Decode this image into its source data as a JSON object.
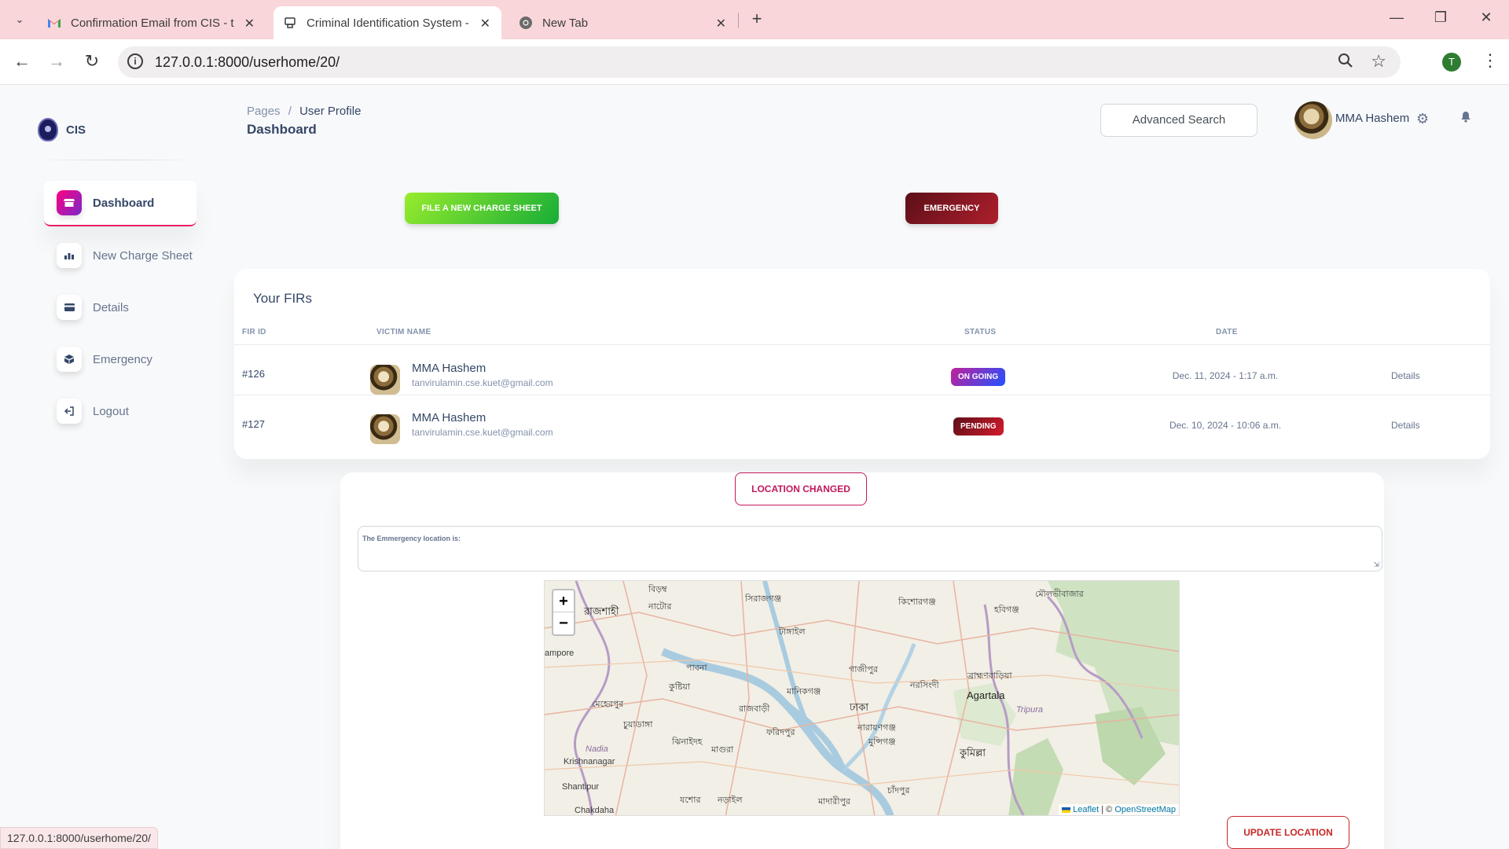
{
  "browser": {
    "tabs": [
      {
        "title": "Confirmation Email from CIS - t",
        "favicon": "gmail-icon",
        "active": false
      },
      {
        "title": "Criminal Identification System -",
        "favicon": "app-icon",
        "active": true
      },
      {
        "title": "New Tab",
        "favicon": "chrome-icon",
        "active": false
      }
    ],
    "url": "127.0.0.1:8000/userhome/20/",
    "profile_initial": "T",
    "status_url": "127.0.0.1:8000/userhome/20/"
  },
  "sidebar": {
    "brand": "CIS",
    "items": [
      {
        "label": "Dashboard",
        "icon": "shop-icon",
        "active": true
      },
      {
        "label": "New Charge Sheet",
        "icon": "chart-icon",
        "active": false
      },
      {
        "label": "Details",
        "icon": "credit-card-icon",
        "active": false
      },
      {
        "label": "Emergency",
        "icon": "box-icon",
        "active": false
      },
      {
        "label": "Logout",
        "icon": "logout-icon",
        "active": false
      }
    ]
  },
  "header": {
    "breadcrumb_parent": "Pages",
    "breadcrumb_sep": "/",
    "breadcrumb_current": "User Profile",
    "title": "Dashboard",
    "search_label": "Advanced Search",
    "user_name": "MMA Hashem"
  },
  "actions": {
    "file_charge_sheet": "FILE A NEW CHARGE SHEET",
    "emergency": "EMERGENCY"
  },
  "firs": {
    "title": "Your FIRs",
    "columns": [
      "FIR ID",
      "VICTIM NAME",
      "STATUS",
      "DATE"
    ],
    "rows": [
      {
        "id": "#126",
        "name": "MMA Hashem",
        "email": "tanvirulamin.cse.kuet@gmail.com",
        "status": "ON GOING",
        "date": "Dec. 11, 2024 - 1:17 a.m.",
        "action": "Details"
      },
      {
        "id": "#127",
        "name": "MMA Hashem",
        "email": "tanvirulamin.cse.kuet@gmail.com",
        "status": "PENDING",
        "date": "Dec. 10, 2024 - 10:06 a.m.",
        "action": "Details"
      }
    ]
  },
  "location": {
    "changed_label": "LOCATION CHANGED",
    "field_label": "The Emmergency location is:",
    "update_label": "UPDATE LOCATION"
  },
  "map": {
    "zoom_in": "+",
    "zoom_out": "−",
    "attribution_leaflet": "Leaflet",
    "attribution_sep": "| ©",
    "attribution_osm": "OpenStreetMap",
    "labels": {
      "rajshahi": "রাজশাহী",
      "natore": "নাটোর",
      "sirajganj": "সিরাজগঞ্জ",
      "kishoreganj": "কিশোরগঞ্জ",
      "habiganj": "হবিগঞ্জ",
      "moulvibazar": "মৌলভীবাজার",
      "tangail": "টাঙ্গাইল",
      "pabna": "পাবনা",
      "gazipur": "গাজীপুর",
      "narsingdi": "নরসিংদী",
      "brahmanbaria": "ব্রাহ্মণবাড়িয়া",
      "kushtia": "কুষ্টিয়া",
      "manikganj": "মানিকগঞ্জ",
      "agartala": "Agartala",
      "rajbari": "রাজবাড়ী",
      "dhaka": "ঢাকা",
      "tripura": "Tripura",
      "meherpur": "মেহেরপুর",
      "chuadanga": "চুয়াডাঙ্গা",
      "faridpur": "ফরিদপুর",
      "narayanganj": "নারায়ণগঞ্জ",
      "munshiganj": "মুন্সিগঞ্জ",
      "jhenaidah": "ঝিনাইদহ",
      "magura": "মাগুরা",
      "nadia": "Nadia",
      "comilla": "কুমিল্লা",
      "krishnanagar": "Krishnanagar",
      "shantipur": "Shantipur",
      "jessore": "যশোর",
      "narail": "নড়াইল",
      "madaripur": "মাদারীপুর",
      "chandpur": "চাঁদপুর",
      "chakdaha": "Chakdaha",
      "rampore": "ampore",
      "bidyanath": "বিড়ম্ব"
    }
  }
}
